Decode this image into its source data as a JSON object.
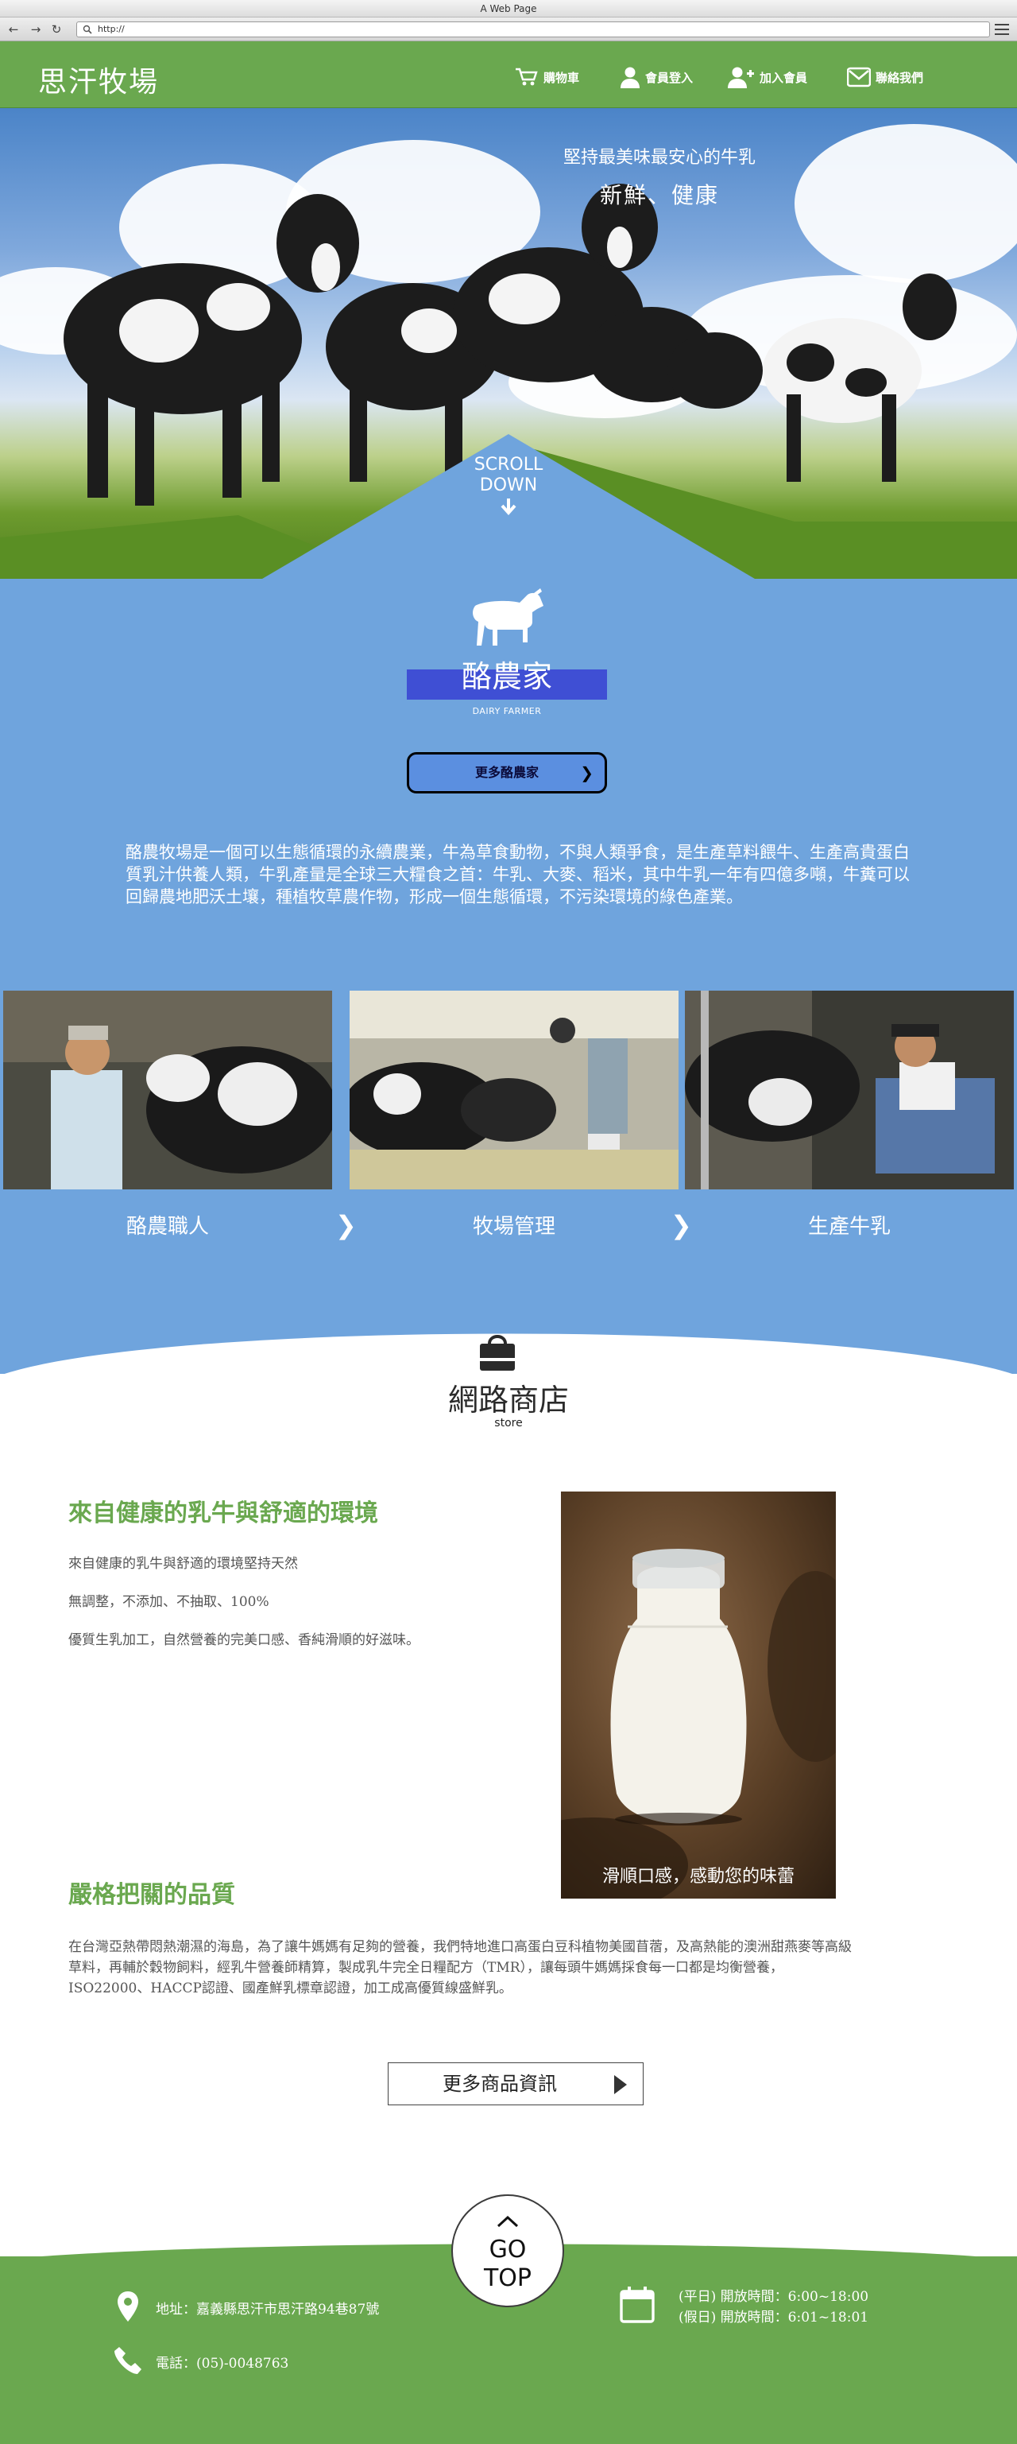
{
  "browser": {
    "title": "A Web Page",
    "url": "http://"
  },
  "header": {
    "logo": "思汗牧場",
    "nav": [
      {
        "label": "購物車",
        "icon": "cart-icon"
      },
      {
        "label": "會員登入",
        "icon": "user-icon"
      },
      {
        "label": "加入會員",
        "icon": "add-user-icon"
      },
      {
        "label": "聯絡我們",
        "icon": "mail-icon"
      }
    ]
  },
  "hero": {
    "line1": "堅持最美味最安心的牛乳",
    "line2": "新鮮、健康",
    "scroll_line1": "SCROLL",
    "scroll_line2": "DOWN"
  },
  "farmer": {
    "title": "酪農家",
    "subtitle": "DAIRY FARMER",
    "more_button": "更多酪農家",
    "description": "酪農牧場是一個可以生態循環的永續農業，牛為草食動物，不與人類爭食，是生產草料餵牛、生產高貴蛋白質乳汁供養人類，牛乳產量是全球三大糧食之首：牛乳、大麥、稻米，其中牛乳一年有四億多噸，牛糞可以回歸農地肥沃土壤，種植牧草農作物，形成一個生態循環，不污染環境的綠色產業。",
    "steps": [
      {
        "caption": "酪農職人"
      },
      {
        "caption": "牧場管理"
      },
      {
        "caption": "生產牛乳"
      }
    ]
  },
  "store": {
    "title": "網路商店",
    "subtitle": "store",
    "section1_title": "來自健康的乳牛與舒適的環境",
    "section1_lines": [
      "來自健康的乳牛與舒適的環境堅持天然",
      "無調整，不添加、不抽取、100%",
      "優質生乳加工，自然營養的完美口感、香純滑順的好滋味。"
    ],
    "photo_caption": "滑順口感，感動您的味蕾",
    "section2_title": "嚴格把關的品質",
    "section2_text": "在台灣亞熱帶悶熱潮濕的海島，為了讓牛媽媽有足夠的營養，我們特地進口高蛋白豆科植物美國苜蓿，及高熱能的澳洲甜燕麥等高級草料，再輔於穀物飼料，經乳牛營養師精算，製成乳牛完全日糧配方（TMR），讓每頭牛媽媽採食每一口都是均衡營養，ISO22000、HACCP認證、國產鮮乳標章認證，加工成高優質線盛鮮乳。",
    "more_button": "更多商品資訊"
  },
  "footer": {
    "go_top_line1": "GO",
    "go_top_line2": "TOP",
    "address": "地址：嘉義縣思汗市思汗路94巷87號",
    "phone": "電話：(05)-0048763",
    "hours_weekday": "(平日) 開放時間：6:00~18:00",
    "hours_holiday": "(假日) 開放時間：6:01~18:01"
  },
  "colors": {
    "header_green": "#6aa84f",
    "section_blue": "#6fa4dd",
    "title_blue": "#3f4fd4"
  }
}
